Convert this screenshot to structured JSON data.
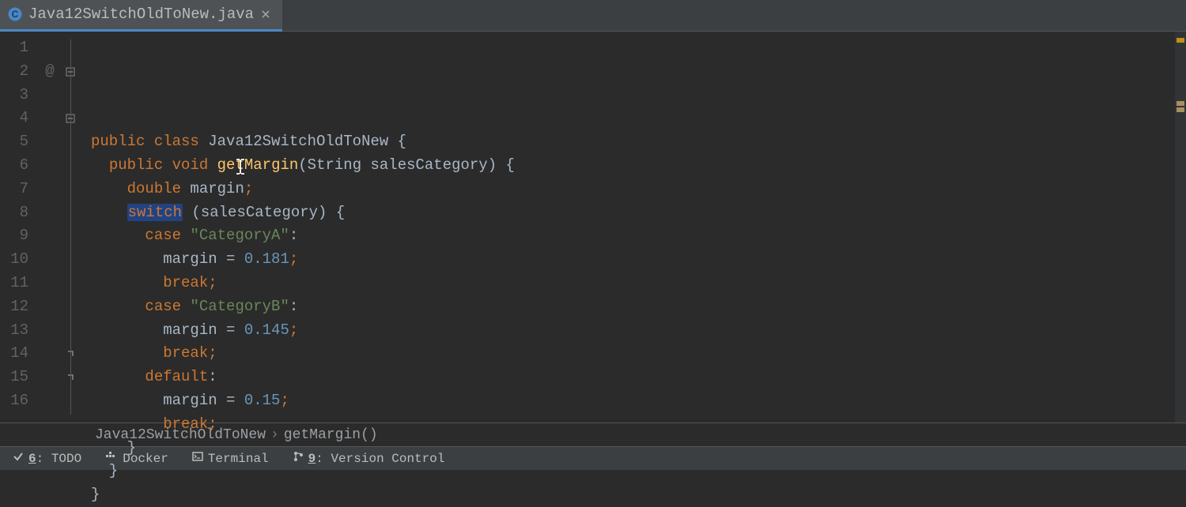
{
  "tab": {
    "filename": "Java12SwitchOldToNew.java"
  },
  "gutter": {
    "count": 16,
    "annotationLine": 2,
    "annotationGlyph": "@",
    "folds": [
      {
        "line": 2,
        "kind": "open"
      },
      {
        "line": 4,
        "kind": "open"
      },
      {
        "line": 14,
        "kind": "close"
      },
      {
        "line": 15,
        "kind": "close"
      }
    ]
  },
  "code": [
    [
      {
        "t": "public",
        "c": "kw"
      },
      {
        "t": " ",
        "c": ""
      },
      {
        "t": "class",
        "c": "kw"
      },
      {
        "t": " Java12SwitchOldToNew {",
        "c": "id"
      }
    ],
    [
      {
        "t": "  ",
        "c": ""
      },
      {
        "t": "public",
        "c": "kw"
      },
      {
        "t": " ",
        "c": ""
      },
      {
        "t": "void",
        "c": "kw"
      },
      {
        "t": " ",
        "c": ""
      },
      {
        "t": "getMargin",
        "c": "fn"
      },
      {
        "t": "(String salesCategory) {",
        "c": "id"
      }
    ],
    [
      {
        "t": "    ",
        "c": ""
      },
      {
        "t": "double",
        "c": "kw"
      },
      {
        "t": " margin",
        "c": "id"
      },
      {
        "t": ";",
        "c": "semi"
      }
    ],
    [
      {
        "t": "    ",
        "c": ""
      },
      {
        "t": "switch",
        "c": "kw hl"
      },
      {
        "t": " (salesCategory) {",
        "c": "id"
      }
    ],
    [
      {
        "t": "      ",
        "c": ""
      },
      {
        "t": "case",
        "c": "kw"
      },
      {
        "t": " ",
        "c": ""
      },
      {
        "t": "\"CategoryA\"",
        "c": "st"
      },
      {
        "t": ":",
        "c": "id"
      }
    ],
    [
      {
        "t": "        margin = ",
        "c": "id"
      },
      {
        "t": "0.181",
        "c": "nu"
      },
      {
        "t": ";",
        "c": "semi"
      }
    ],
    [
      {
        "t": "        ",
        "c": ""
      },
      {
        "t": "break",
        "c": "kw"
      },
      {
        "t": ";",
        "c": "semi"
      }
    ],
    [
      {
        "t": "      ",
        "c": ""
      },
      {
        "t": "case",
        "c": "kw"
      },
      {
        "t": " ",
        "c": ""
      },
      {
        "t": "\"CategoryB\"",
        "c": "st"
      },
      {
        "t": ":",
        "c": "id"
      }
    ],
    [
      {
        "t": "        margin = ",
        "c": "id"
      },
      {
        "t": "0.145",
        "c": "nu"
      },
      {
        "t": ";",
        "c": "semi"
      }
    ],
    [
      {
        "t": "        ",
        "c": ""
      },
      {
        "t": "break",
        "c": "kw"
      },
      {
        "t": ";",
        "c": "semi"
      }
    ],
    [
      {
        "t": "      ",
        "c": ""
      },
      {
        "t": "default",
        "c": "kw"
      },
      {
        "t": ":",
        "c": "id"
      }
    ],
    [
      {
        "t": "        margin = ",
        "c": "id"
      },
      {
        "t": "0.15",
        "c": "nu"
      },
      {
        "t": ";",
        "c": "semi"
      }
    ],
    [
      {
        "t": "        ",
        "c": ""
      },
      {
        "t": "break",
        "c": "kw"
      },
      {
        "t": ";",
        "c": "semi"
      }
    ],
    [
      {
        "t": "    }",
        "c": "id"
      }
    ],
    [
      {
        "t": "  }",
        "c": "id"
      }
    ],
    [
      {
        "t": "}",
        "c": "id"
      }
    ]
  ],
  "breadcrumb": {
    "class": "Java12SwitchOldToNew",
    "method": "getMargin()"
  },
  "tools": {
    "todo": {
      "num": "6",
      "label": "TODO"
    },
    "docker": "Docker",
    "terminal": "Terminal",
    "vcs": {
      "num": "9",
      "label": "Version Control"
    }
  }
}
